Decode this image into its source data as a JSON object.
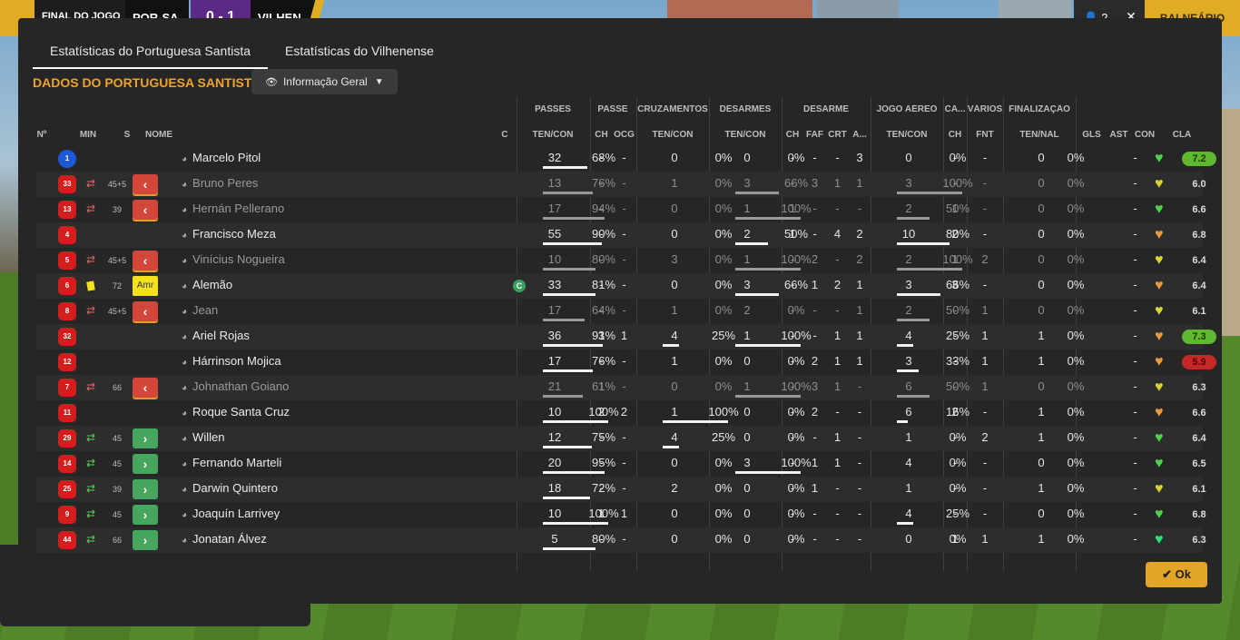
{
  "topbar": {
    "final_label": "FINAL DO JOGO",
    "home_team": "POR-SA",
    "score": "0 - 1",
    "away_team": "VILHEN",
    "right_count": "2",
    "right_close": "✕",
    "balneario": "BALNEÁRIO"
  },
  "tabs": [
    {
      "label": "Estatísticas do Portuguesa Santista"
    },
    {
      "label": "Estatísticas do Vilhenense"
    }
  ],
  "section_title": "DADOS DO PORTUGUESA SANTISTA",
  "dropdown": {
    "selected": "Informação Geral"
  },
  "group_headers": {
    "passes": "PASSES",
    "passe": "PASSE",
    "cruzamentos": "CRUZAMENTOS",
    "desarmes": "DESARMES",
    "desarme": "DESARME",
    "jogo_aereo": "JOGO AÉREO",
    "ca": "CA...",
    "varios": "VÁRIOS",
    "finalizacao": "FINALIZAÇÃO"
  },
  "columns": {
    "num": "Nº",
    "min": "MIN",
    "s": "S",
    "nome": "NOME",
    "c": "C",
    "ten_con_passes": "TEN/CON",
    "ch_passe": "CH",
    "ocg": "OCG",
    "ten_con_cruz": "TEN/CON",
    "ten_con_des": "TEN/CON",
    "ch_desarme": "CH",
    "faf": "FAF",
    "crt": "CRT",
    "a": "A...",
    "ten_con_aereo": "TEN/CON",
    "ch_ca": "CH",
    "fnt": "FNT",
    "ten_nal": "TEN/NAL",
    "gls": "GLS",
    "ast": "AST",
    "con": "CON",
    "cla": "CLA"
  },
  "colors": {
    "accent": "#f0a22a",
    "ok_button": "#e3a526",
    "sub_out": "#d4453a",
    "sub_in": "#47a65d",
    "rating_high": "#5fb830",
    "rating_low": "#c62828"
  },
  "players": [
    {
      "num": "1",
      "gk": true,
      "sub": "",
      "min": "",
      "s": "",
      "name": "Marcelo Pitol",
      "cap": false,
      "passes": {
        "ten": "32",
        "pct": "68%",
        "frac": 0.68
      },
      "ch_passe": "-",
      "ocg": "-",
      "cruz": {
        "ten": "0",
        "pct": "0%",
        "frac": 0
      },
      "des": {
        "ten": "0",
        "pct": "0%",
        "frac": 0
      },
      "ch_d": "-",
      "faf": "-",
      "crt": "-",
      "a": "3",
      "aereo": {
        "ten": "0",
        "pct": "0%",
        "frac": 0
      },
      "ch_ca": "-",
      "fnt": "-",
      "fin": {
        "ten": "0",
        "pct": "0%"
      },
      "gls": "",
      "ast": "-",
      "con": "green-heart",
      "cla": "7.2",
      "cla_style": "green"
    },
    {
      "num": "33",
      "gk": false,
      "sub": "out",
      "min": "45+5",
      "s": "<",
      "name": "Bruno Peres",
      "cap": false,
      "passes": {
        "ten": "13",
        "pct": "76%",
        "frac": 0.76
      },
      "ch_passe": "-",
      "ocg": "-",
      "cruz": {
        "ten": "1",
        "pct": "0%",
        "frac": 0
      },
      "des": {
        "ten": "3",
        "pct": "66%",
        "frac": 0.66
      },
      "ch_d": "-",
      "faf": "3",
      "crt": "1",
      "a": "1",
      "aereo": {
        "ten": "3",
        "pct": "100%",
        "frac": 1
      },
      "ch_ca": "-",
      "fnt": "-",
      "fin": {
        "ten": "0",
        "pct": "0%"
      },
      "gls": "",
      "ast": "-",
      "con": "yellow-heart",
      "cla": "6.0",
      "cla_style": ""
    },
    {
      "num": "13",
      "gk": false,
      "sub": "out",
      "min": "39",
      "s": "<",
      "name": "Hernán Pellerano",
      "cap": false,
      "passes": {
        "ten": "17",
        "pct": "94%",
        "frac": 0.94
      },
      "ch_passe": "-",
      "ocg": "-",
      "cruz": {
        "ten": "0",
        "pct": "0%",
        "frac": 0
      },
      "des": {
        "ten": "1",
        "pct": "100%",
        "frac": 1
      },
      "ch_d": "1",
      "faf": "-",
      "crt": "-",
      "a": "-",
      "aereo": {
        "ten": "2",
        "pct": "50%",
        "frac": 0.5
      },
      "ch_ca": "1",
      "fnt": "-",
      "fin": {
        "ten": "0",
        "pct": "0%"
      },
      "gls": "",
      "ast": "-",
      "con": "green-heart",
      "cla": "6.6",
      "cla_style": ""
    },
    {
      "num": "4",
      "gk": false,
      "sub": "",
      "min": "",
      "s": "",
      "name": "Francisco Meza",
      "cap": false,
      "passes": {
        "ten": "55",
        "pct": "90%",
        "frac": 0.9
      },
      "ch_passe": "-",
      "ocg": "-",
      "cruz": {
        "ten": "0",
        "pct": "0%",
        "frac": 0
      },
      "des": {
        "ten": "2",
        "pct": "50%",
        "frac": 0.5
      },
      "ch_d": "1",
      "faf": "-",
      "crt": "4",
      "a": "2",
      "aereo": {
        "ten": "10",
        "pct": "80%",
        "frac": 0.8
      },
      "ch_ca": "2",
      "fnt": "-",
      "fin": {
        "ten": "0",
        "pct": "0%"
      },
      "gls": "",
      "ast": "-",
      "con": "orange-heart",
      "cla": "6.8",
      "cla_style": ""
    },
    {
      "num": "5",
      "gk": false,
      "sub": "out",
      "min": "45+5",
      "s": "<",
      "name": "Vinícius Nogueira",
      "cap": false,
      "passes": {
        "ten": "10",
        "pct": "80%",
        "frac": 0.8
      },
      "ch_passe": "-",
      "ocg": "-",
      "cruz": {
        "ten": "3",
        "pct": "0%",
        "frac": 0
      },
      "des": {
        "ten": "1",
        "pct": "100%",
        "frac": 1
      },
      "ch_d": "-",
      "faf": "2",
      "crt": "-",
      "a": "2",
      "aereo": {
        "ten": "2",
        "pct": "100%",
        "frac": 1
      },
      "ch_ca": "1",
      "fnt": "2",
      "fin": {
        "ten": "0",
        "pct": "0%"
      },
      "gls": "",
      "ast": "-",
      "con": "yellow-heart",
      "cla": "6.4",
      "cla_style": ""
    },
    {
      "num": "6",
      "gk": false,
      "sub": "card",
      "min": "72",
      "s": "Amr",
      "name": "Alemão",
      "cap": true,
      "cap_letter": "C",
      "passes": {
        "ten": "33",
        "pct": "81%",
        "frac": 0.81
      },
      "ch_passe": "-",
      "ocg": "-",
      "cruz": {
        "ten": "0",
        "pct": "0%",
        "frac": 0
      },
      "des": {
        "ten": "3",
        "pct": "66%",
        "frac": 0.66
      },
      "ch_d": "-",
      "faf": "1",
      "crt": "2",
      "a": "1",
      "aereo": {
        "ten": "3",
        "pct": "66%",
        "frac": 0.66
      },
      "ch_ca": "3",
      "fnt": "-",
      "fin": {
        "ten": "0",
        "pct": "0%"
      },
      "gls": "",
      "ast": "-",
      "con": "orange-heart",
      "cla": "6.4",
      "cla_style": ""
    },
    {
      "num": "8",
      "gk": false,
      "sub": "out",
      "min": "45+5",
      "s": "<",
      "name": "Jean",
      "cap": false,
      "passes": {
        "ten": "17",
        "pct": "64%",
        "frac": 0.64
      },
      "ch_passe": "-",
      "ocg": "-",
      "cruz": {
        "ten": "1",
        "pct": "0%",
        "frac": 0
      },
      "des": {
        "ten": "2",
        "pct": "0%",
        "frac": 0
      },
      "ch_d": "-",
      "faf": "-",
      "crt": "-",
      "a": "1",
      "aereo": {
        "ten": "2",
        "pct": "50%",
        "frac": 0.5
      },
      "ch_ca": "-",
      "fnt": "1",
      "fin": {
        "ten": "0",
        "pct": "0%"
      },
      "gls": "",
      "ast": "-",
      "con": "yellow-heart",
      "cla": "6.1",
      "cla_style": ""
    },
    {
      "num": "32",
      "gk": false,
      "sub": "",
      "min": "",
      "s": "",
      "name": "Ariel Rojas",
      "cap": false,
      "passes": {
        "ten": "36",
        "pct": "91%",
        "frac": 0.91
      },
      "ch_passe": "3",
      "ocg": "1",
      "cruz": {
        "ten": "4",
        "pct": "25%",
        "frac": 0.25
      },
      "des": {
        "ten": "1",
        "pct": "100%",
        "frac": 1
      },
      "ch_d": "-",
      "faf": "-",
      "crt": "1",
      "a": "1",
      "aereo": {
        "ten": "4",
        "pct": "25%",
        "frac": 0.25
      },
      "ch_ca": "-",
      "fnt": "1",
      "fin": {
        "ten": "1",
        "pct": "0%"
      },
      "gls": "",
      "ast": "-",
      "con": "orange-heart",
      "cla": "7.3",
      "cla_style": "green"
    },
    {
      "num": "12",
      "gk": false,
      "sub": "",
      "min": "",
      "s": "",
      "name": "Hárrinson Mojica",
      "cap": false,
      "passes": {
        "ten": "17",
        "pct": "76%",
        "frac": 0.76
      },
      "ch_passe": "-",
      "ocg": "-",
      "cruz": {
        "ten": "1",
        "pct": "0%",
        "frac": 0
      },
      "des": {
        "ten": "0",
        "pct": "0%",
        "frac": 0
      },
      "ch_d": "-",
      "faf": "2",
      "crt": "1",
      "a": "1",
      "aereo": {
        "ten": "3",
        "pct": "33%",
        "frac": 0.33
      },
      "ch_ca": "-",
      "fnt": "1",
      "fin": {
        "ten": "1",
        "pct": "0%"
      },
      "gls": "",
      "ast": "-",
      "con": "orange-heart",
      "cla": "5.9",
      "cla_style": "red"
    },
    {
      "num": "7",
      "gk": false,
      "sub": "out",
      "min": "66",
      "s": "<",
      "name": "Johnathan Goiano",
      "cap": false,
      "passes": {
        "ten": "21",
        "pct": "61%",
        "frac": 0.61
      },
      "ch_passe": "1",
      "ocg": "-",
      "cruz": {
        "ten": "0",
        "pct": "0%",
        "frac": 0
      },
      "des": {
        "ten": "1",
        "pct": "100%",
        "frac": 1
      },
      "ch_d": "-",
      "faf": "3",
      "crt": "1",
      "a": "-",
      "aereo": {
        "ten": "6",
        "pct": "50%",
        "frac": 0.5
      },
      "ch_ca": "-",
      "fnt": "1",
      "fin": {
        "ten": "0",
        "pct": "0%"
      },
      "gls": "",
      "ast": "-",
      "con": "yellow-heart",
      "cla": "6.3",
      "cla_style": ""
    },
    {
      "num": "11",
      "gk": false,
      "sub": "",
      "min": "",
      "s": "",
      "name": "Roque Santa Cruz",
      "cap": false,
      "passes": {
        "ten": "10",
        "pct": "100%",
        "frac": 1
      },
      "ch_passe": "2",
      "ocg": "2",
      "cruz": {
        "ten": "1",
        "pct": "100%",
        "frac": 1
      },
      "des": {
        "ten": "0",
        "pct": "0%",
        "frac": 0
      },
      "ch_d": "-",
      "faf": "2",
      "crt": "-",
      "a": "-",
      "aereo": {
        "ten": "6",
        "pct": "16%",
        "frac": 0.16
      },
      "ch_ca": "2",
      "fnt": "-",
      "fin": {
        "ten": "1",
        "pct": "0%"
      },
      "gls": "",
      "ast": "-",
      "con": "orange-heart",
      "cla": "6.6",
      "cla_style": ""
    },
    {
      "num": "29",
      "gk": false,
      "sub": "in",
      "min": "45",
      "s": ">",
      "name": "Willen",
      "cap": false,
      "passes": {
        "ten": "12",
        "pct": "75%",
        "frac": 0.75
      },
      "ch_passe": "-",
      "ocg": "-",
      "cruz": {
        "ten": "4",
        "pct": "25%",
        "frac": 0.25
      },
      "des": {
        "ten": "0",
        "pct": "0%",
        "frac": 0
      },
      "ch_d": "-",
      "faf": "-",
      "crt": "1",
      "a": "-",
      "aereo": {
        "ten": "1",
        "pct": "0%",
        "frac": 0
      },
      "ch_ca": "-",
      "fnt": "2",
      "fin": {
        "ten": "1",
        "pct": "0%"
      },
      "gls": "",
      "ast": "-",
      "con": "green-heart",
      "cla": "6.4",
      "cla_style": ""
    },
    {
      "num": "14",
      "gk": false,
      "sub": "in",
      "min": "45",
      "s": ">",
      "name": "Fernando Marteli",
      "cap": false,
      "passes": {
        "ten": "20",
        "pct": "95%",
        "frac": 0.95
      },
      "ch_passe": "-",
      "ocg": "-",
      "cruz": {
        "ten": "0",
        "pct": "0%",
        "frac": 0
      },
      "des": {
        "ten": "3",
        "pct": "100%",
        "frac": 1
      },
      "ch_d": "-",
      "faf": "1",
      "crt": "1",
      "a": "-",
      "aereo": {
        "ten": "4",
        "pct": "0%",
        "frac": 0
      },
      "ch_ca": "-",
      "fnt": "-",
      "fin": {
        "ten": "0",
        "pct": "0%"
      },
      "gls": "",
      "ast": "-",
      "con": "green-heart",
      "cla": "6.5",
      "cla_style": ""
    },
    {
      "num": "25",
      "gk": false,
      "sub": "in",
      "min": "39",
      "s": ">",
      "name": "Darwin Quintero",
      "cap": false,
      "passes": {
        "ten": "18",
        "pct": "72%",
        "frac": 0.72
      },
      "ch_passe": "-",
      "ocg": "-",
      "cruz": {
        "ten": "2",
        "pct": "0%",
        "frac": 0
      },
      "des": {
        "ten": "0",
        "pct": "0%",
        "frac": 0
      },
      "ch_d": "-",
      "faf": "1",
      "crt": "-",
      "a": "-",
      "aereo": {
        "ten": "1",
        "pct": "0%",
        "frac": 0
      },
      "ch_ca": "-",
      "fnt": "-",
      "fin": {
        "ten": "1",
        "pct": "0%"
      },
      "gls": "",
      "ast": "-",
      "con": "yellow-heart",
      "cla": "6.1",
      "cla_style": ""
    },
    {
      "num": "9",
      "gk": false,
      "sub": "in",
      "min": "45",
      "s": ">",
      "name": "Joaquín Larrivey",
      "cap": false,
      "passes": {
        "ten": "10",
        "pct": "100%",
        "frac": 1
      },
      "ch_passe": "1",
      "ocg": "1",
      "cruz": {
        "ten": "0",
        "pct": "0%",
        "frac": 0
      },
      "des": {
        "ten": "0",
        "pct": "0%",
        "frac": 0
      },
      "ch_d": "-",
      "faf": "-",
      "crt": "-",
      "a": "-",
      "aereo": {
        "ten": "4",
        "pct": "25%",
        "frac": 0.25
      },
      "ch_ca": "-",
      "fnt": "-",
      "fin": {
        "ten": "0",
        "pct": "0%"
      },
      "gls": "",
      "ast": "-",
      "con": "green-heart",
      "cla": "6.8",
      "cla_style": ""
    },
    {
      "num": "44",
      "gk": false,
      "sub": "in",
      "min": "66",
      "s": ">",
      "name": "Jonatan Álvez",
      "cap": false,
      "passes": {
        "ten": "5",
        "pct": "80%",
        "frac": 0.8
      },
      "ch_passe": "-",
      "ocg": "-",
      "cruz": {
        "ten": "0",
        "pct": "0%",
        "frac": 0
      },
      "des": {
        "ten": "0",
        "pct": "0%",
        "frac": 0
      },
      "ch_d": "-",
      "faf": "-",
      "crt": "-",
      "a": "-",
      "aereo": {
        "ten": "0",
        "pct": "0%",
        "frac": 0
      },
      "ch_ca": "1",
      "fnt": "1",
      "fin": {
        "ten": "1",
        "pct": "0%"
      },
      "gls": "",
      "ast": "-",
      "con": "bright-green-heart",
      "cla": "6.3",
      "cla_style": ""
    }
  ],
  "ok_button": "Ok"
}
